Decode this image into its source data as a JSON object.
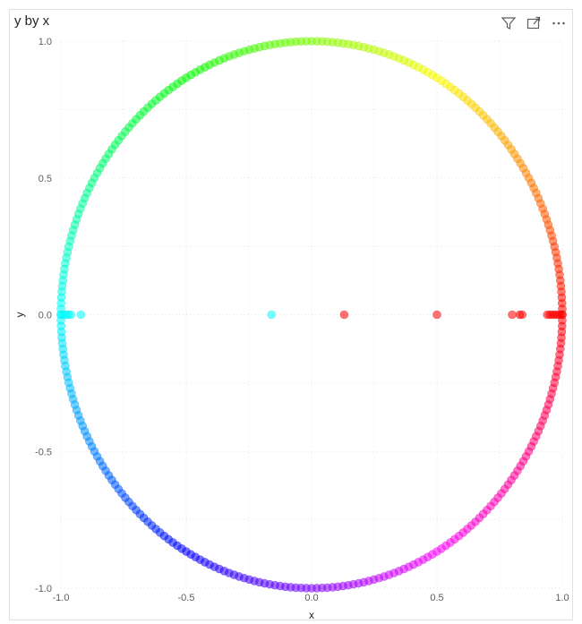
{
  "visual": {
    "title": "y by x"
  },
  "header_icons": [
    "filter-icon",
    "focus-mode-icon",
    "more-options-icon"
  ],
  "chart_data": {
    "type": "scatter",
    "title": "y by x",
    "xlabel": "x",
    "ylabel": "y",
    "xlim": [
      -1.0,
      1.0
    ],
    "ylim": [
      -1.0,
      1.0
    ],
    "xticks": [
      "-1.0",
      "-0.5",
      "0.0",
      "0.5",
      "1.0"
    ],
    "yticks": [
      "-1.0",
      "-0.5",
      "0.0",
      "0.5",
      "1.0"
    ],
    "grid": true,
    "legend": "none",
    "points_description": "~300 points uniformly spaced on the unit circle (x=cos θ, y=sin θ), colored by hue of the angle; plus points along y=0",
    "circle_point_count": 300,
    "axis_points": [
      {
        "x": -1.0,
        "y": 0
      },
      {
        "x": -0.99,
        "y": 0
      },
      {
        "x": -0.98,
        "y": 0
      },
      {
        "x": -0.97,
        "y": 0
      },
      {
        "x": -0.96,
        "y": 0
      },
      {
        "x": -0.92,
        "y": 0
      },
      {
        "x": -0.16,
        "y": 0
      },
      {
        "x": 0.13,
        "y": 0
      },
      {
        "x": 0.5,
        "y": 0
      },
      {
        "x": 0.8,
        "y": 0
      },
      {
        "x": 0.83,
        "y": 0
      },
      {
        "x": 0.84,
        "y": 0
      },
      {
        "x": 0.94,
        "y": 0
      },
      {
        "x": 0.95,
        "y": 0
      },
      {
        "x": 0.96,
        "y": 0
      },
      {
        "x": 0.97,
        "y": 0
      },
      {
        "x": 0.98,
        "y": 0
      },
      {
        "x": 0.99,
        "y": 0
      },
      {
        "x": 1.0,
        "y": 0
      }
    ],
    "marker_opacity": 0.55
  }
}
